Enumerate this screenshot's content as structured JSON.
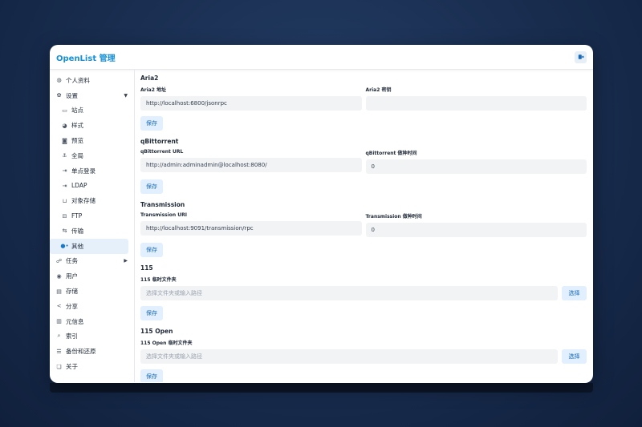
{
  "header": {
    "title": "OpenList 管理",
    "logout_icon": "logout-icon"
  },
  "sidebar": {
    "items": [
      {
        "label": "个人资料",
        "icon": "user-circle-icon"
      },
      {
        "label": "设置",
        "icon": "gear-icon",
        "expanded": true
      },
      {
        "label": "站点",
        "icon": "window-icon"
      },
      {
        "label": "样式",
        "icon": "palette-icon"
      },
      {
        "label": "预览",
        "icon": "camera-icon"
      },
      {
        "label": "全局",
        "icon": "anchor-icon"
      },
      {
        "label": "单点登录",
        "icon": "login-icon"
      },
      {
        "label": "LDAP",
        "icon": "login-icon"
      },
      {
        "label": "对象存储",
        "icon": "bucket-icon"
      },
      {
        "label": "FTP",
        "icon": "ftp-icon"
      },
      {
        "label": "传输",
        "icon": "transfer-icon"
      },
      {
        "label": "其他",
        "icon": "dots-icon",
        "active": true
      },
      {
        "label": "任务",
        "icon": "task-icon"
      },
      {
        "label": "用户",
        "icon": "user-icon"
      },
      {
        "label": "存储",
        "icon": "database-icon"
      },
      {
        "label": "分享",
        "icon": "share-icon"
      },
      {
        "label": "元信息",
        "icon": "meta-icon"
      },
      {
        "label": "索引",
        "icon": "search-icon"
      },
      {
        "label": "备份和还原",
        "icon": "backup-icon"
      },
      {
        "label": "关于",
        "icon": "info-icon"
      }
    ]
  },
  "sections": {
    "aria2": {
      "title": "Aria2",
      "url_label": "Aria2 地址",
      "url_value": "http://localhost:6800/jsonrpc",
      "secret_label": "Aria2 密钥",
      "secret_value": "",
      "save": "保存"
    },
    "qbit": {
      "title": "qBittorrent",
      "url_label": "qBittorrent URL",
      "url_value": "http://admin:adminadmin@localhost:8080/",
      "seed_label": "qBittorrent 做种时间",
      "seed_value": "0",
      "save": "保存"
    },
    "transmission": {
      "title": "Transmission",
      "url_label": "Transmission URI",
      "url_value": "http://localhost:9091/transmission/rpc",
      "seed_label": "Transmission 做种时间",
      "seed_value": "0",
      "save": "保存"
    },
    "p115": {
      "title": "115",
      "path_label": "115 临时文件夹",
      "path_placeholder": "选择文件夹或输入路径",
      "pick": "选择",
      "save": "保存"
    },
    "p115open": {
      "title": "115 Open",
      "path_label": "115 Open 临时文件夹",
      "path_placeholder": "选择文件夹或输入路径",
      "pick": "选择",
      "save": "保存"
    }
  }
}
